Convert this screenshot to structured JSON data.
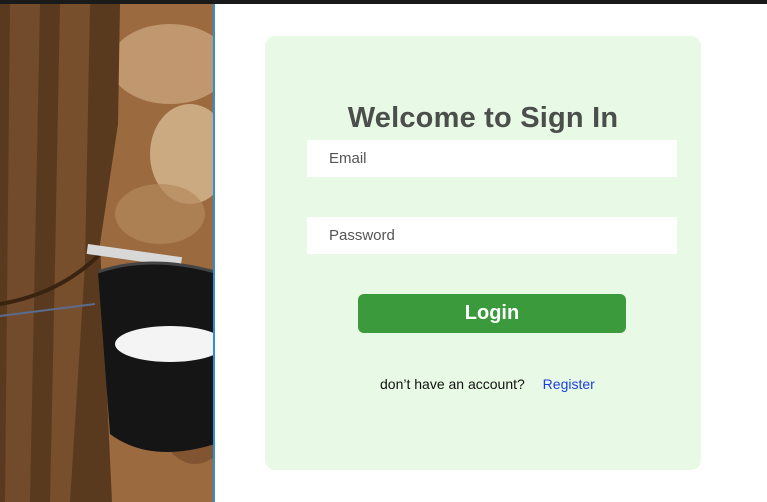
{
  "login": {
    "title": "Welcome to Sign In",
    "email_placeholder": "Email",
    "password_placeholder": "Password",
    "login_label": "Login",
    "no_account_text": "don’t have an account?",
    "register_label": "Register"
  },
  "colors": {
    "card_bg": "#e8f9e5",
    "button_bg": "#3a9a3c",
    "link": "#1b3fe0",
    "title": "#4b4f4b"
  }
}
